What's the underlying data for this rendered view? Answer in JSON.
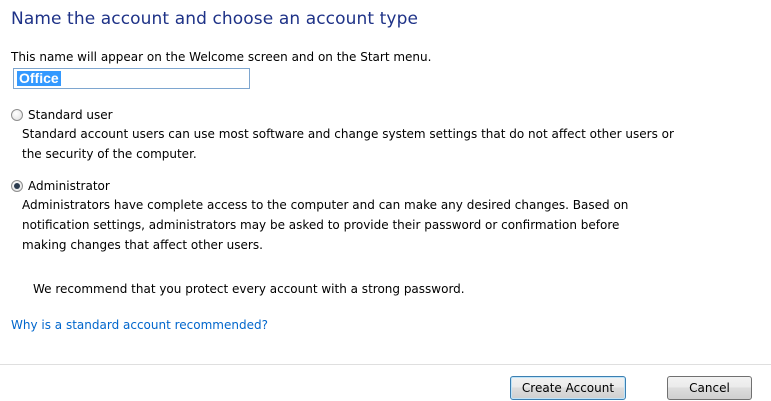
{
  "title": "Name the account and choose an account type",
  "hint": "This name will appear on the Welcome screen and on the Start menu.",
  "name_field": {
    "value": "Office"
  },
  "options": [
    {
      "label": "Standard user",
      "checked": false,
      "desc_lines": [
        "Standard account users can use most software and change system settings that do not affect other users or",
        "the security of the computer."
      ]
    },
    {
      "label": "Administrator",
      "checked": true,
      "desc_lines": [
        "Administrators have complete access to the computer and can make any desired changes. Based on",
        "notification settings, administrators may be asked to provide their password or confirmation before",
        "making changes that affect other users."
      ]
    }
  ],
  "recommend": "We recommend that you protect every account with a strong password.",
  "link": "Why is a standard account recommended?",
  "buttons": {
    "create": "Create Account",
    "cancel": "Cancel"
  },
  "colors": {
    "title": "#1e3287",
    "link": "#0066cc",
    "selection": "#3399ff"
  }
}
